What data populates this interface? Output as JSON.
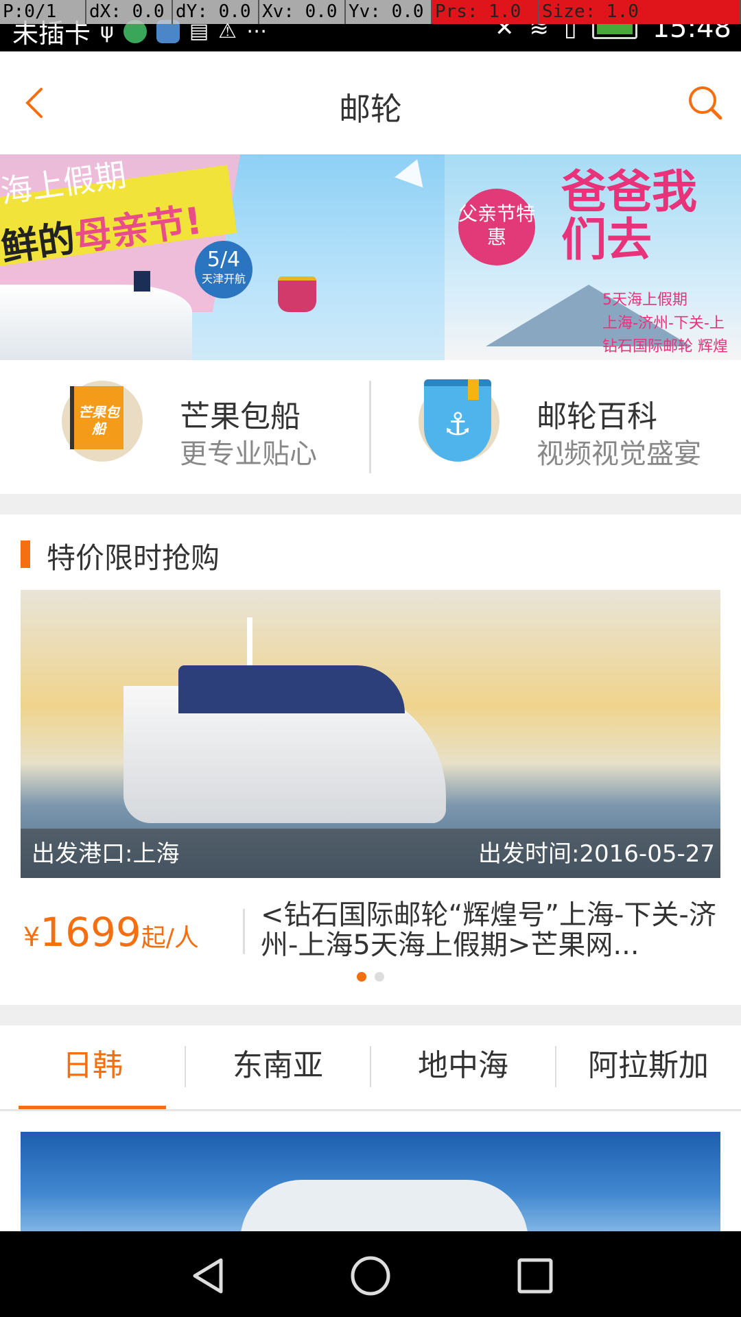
{
  "status_bar": {
    "debug": [
      "P:0/1",
      "dX: 0.0",
      "dY: 0.0",
      "Xv: 0.0",
      "Yv: 0.0",
      "Prs: 1.0",
      "Size: 1.0"
    ],
    "carrier": "未插卡",
    "time": "15:48"
  },
  "header": {
    "title": "邮轮",
    "back_icon": "chevron-left-icon",
    "search_icon": "search-icon",
    "accent_color": "#f56e0f"
  },
  "banner": {
    "left": {
      "line1": "海上假期",
      "line2_prefix": "鲜的",
      "line2_highlight": "母亲节!",
      "badge_date": "5/4",
      "badge_text": "天津开航"
    },
    "right": {
      "badge": "父亲节特惠",
      "title": "爸爸我们去",
      "sub1": "5天海上假期",
      "sub2": "上海-济州-下关-上",
      "sub3": "钻石国际邮轮 辉煌"
    },
    "active_dot": 1
  },
  "quick_entries": [
    {
      "title": "芒果包船",
      "subtitle": "更专业贴心",
      "icon_label": "芒果包船",
      "icon": "flag-icon"
    },
    {
      "title": "邮轮百科",
      "subtitle": "视频视觉盛宴",
      "icon": "anchor-book-icon"
    }
  ],
  "flash_sale": {
    "section_title": "特价限时抢购",
    "departure_port": "出发港口:上海",
    "departure_time": "出发时间:2016-05-27",
    "price_currency": "¥",
    "price_value": "1699",
    "price_unit": "起/人",
    "deal_title": "<钻石国际邮轮“辉煌号”上海-下关-济州-上海5天海上假期>芒果网...",
    "active_dot": 0
  },
  "tabs": [
    {
      "label": "日韩",
      "active": true
    },
    {
      "label": "东南亚",
      "active": false
    },
    {
      "label": "地中海",
      "active": false
    },
    {
      "label": "阿拉斯加",
      "active": false
    }
  ],
  "nav_bar": {
    "back": "back-triangle-icon",
    "home": "home-circle-icon",
    "recents": "recents-square-icon"
  }
}
